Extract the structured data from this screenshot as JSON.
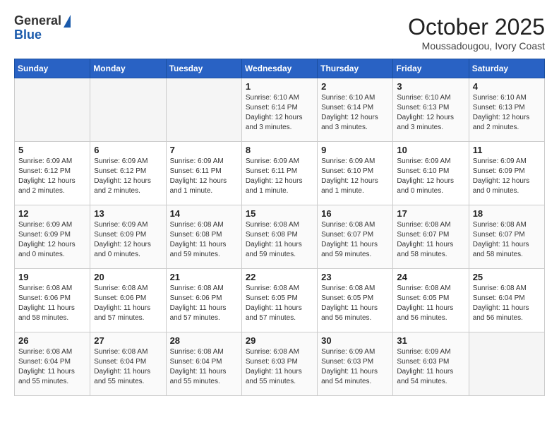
{
  "header": {
    "logo_general": "General",
    "logo_blue": "Blue",
    "title": "October 2025",
    "subtitle": "Moussadougou, Ivory Coast"
  },
  "weekdays": [
    "Sunday",
    "Monday",
    "Tuesday",
    "Wednesday",
    "Thursday",
    "Friday",
    "Saturday"
  ],
  "weeks": [
    [
      {
        "day": "",
        "info": ""
      },
      {
        "day": "",
        "info": ""
      },
      {
        "day": "",
        "info": ""
      },
      {
        "day": "1",
        "info": "Sunrise: 6:10 AM\nSunset: 6:14 PM\nDaylight: 12 hours\nand 3 minutes."
      },
      {
        "day": "2",
        "info": "Sunrise: 6:10 AM\nSunset: 6:14 PM\nDaylight: 12 hours\nand 3 minutes."
      },
      {
        "day": "3",
        "info": "Sunrise: 6:10 AM\nSunset: 6:13 PM\nDaylight: 12 hours\nand 3 minutes."
      },
      {
        "day": "4",
        "info": "Sunrise: 6:10 AM\nSunset: 6:13 PM\nDaylight: 12 hours\nand 2 minutes."
      }
    ],
    [
      {
        "day": "5",
        "info": "Sunrise: 6:09 AM\nSunset: 6:12 PM\nDaylight: 12 hours\nand 2 minutes."
      },
      {
        "day": "6",
        "info": "Sunrise: 6:09 AM\nSunset: 6:12 PM\nDaylight: 12 hours\nand 2 minutes."
      },
      {
        "day": "7",
        "info": "Sunrise: 6:09 AM\nSunset: 6:11 PM\nDaylight: 12 hours\nand 1 minute."
      },
      {
        "day": "8",
        "info": "Sunrise: 6:09 AM\nSunset: 6:11 PM\nDaylight: 12 hours\nand 1 minute."
      },
      {
        "day": "9",
        "info": "Sunrise: 6:09 AM\nSunset: 6:10 PM\nDaylight: 12 hours\nand 1 minute."
      },
      {
        "day": "10",
        "info": "Sunrise: 6:09 AM\nSunset: 6:10 PM\nDaylight: 12 hours\nand 0 minutes."
      },
      {
        "day": "11",
        "info": "Sunrise: 6:09 AM\nSunset: 6:09 PM\nDaylight: 12 hours\nand 0 minutes."
      }
    ],
    [
      {
        "day": "12",
        "info": "Sunrise: 6:09 AM\nSunset: 6:09 PM\nDaylight: 12 hours\nand 0 minutes."
      },
      {
        "day": "13",
        "info": "Sunrise: 6:09 AM\nSunset: 6:09 PM\nDaylight: 12 hours\nand 0 minutes."
      },
      {
        "day": "14",
        "info": "Sunrise: 6:08 AM\nSunset: 6:08 PM\nDaylight: 11 hours\nand 59 minutes."
      },
      {
        "day": "15",
        "info": "Sunrise: 6:08 AM\nSunset: 6:08 PM\nDaylight: 11 hours\nand 59 minutes."
      },
      {
        "day": "16",
        "info": "Sunrise: 6:08 AM\nSunset: 6:07 PM\nDaylight: 11 hours\nand 59 minutes."
      },
      {
        "day": "17",
        "info": "Sunrise: 6:08 AM\nSunset: 6:07 PM\nDaylight: 11 hours\nand 58 minutes."
      },
      {
        "day": "18",
        "info": "Sunrise: 6:08 AM\nSunset: 6:07 PM\nDaylight: 11 hours\nand 58 minutes."
      }
    ],
    [
      {
        "day": "19",
        "info": "Sunrise: 6:08 AM\nSunset: 6:06 PM\nDaylight: 11 hours\nand 58 minutes."
      },
      {
        "day": "20",
        "info": "Sunrise: 6:08 AM\nSunset: 6:06 PM\nDaylight: 11 hours\nand 57 minutes."
      },
      {
        "day": "21",
        "info": "Sunrise: 6:08 AM\nSunset: 6:06 PM\nDaylight: 11 hours\nand 57 minutes."
      },
      {
        "day": "22",
        "info": "Sunrise: 6:08 AM\nSunset: 6:05 PM\nDaylight: 11 hours\nand 57 minutes."
      },
      {
        "day": "23",
        "info": "Sunrise: 6:08 AM\nSunset: 6:05 PM\nDaylight: 11 hours\nand 56 minutes."
      },
      {
        "day": "24",
        "info": "Sunrise: 6:08 AM\nSunset: 6:05 PM\nDaylight: 11 hours\nand 56 minutes."
      },
      {
        "day": "25",
        "info": "Sunrise: 6:08 AM\nSunset: 6:04 PM\nDaylight: 11 hours\nand 56 minutes."
      }
    ],
    [
      {
        "day": "26",
        "info": "Sunrise: 6:08 AM\nSunset: 6:04 PM\nDaylight: 11 hours\nand 55 minutes."
      },
      {
        "day": "27",
        "info": "Sunrise: 6:08 AM\nSunset: 6:04 PM\nDaylight: 11 hours\nand 55 minutes."
      },
      {
        "day": "28",
        "info": "Sunrise: 6:08 AM\nSunset: 6:04 PM\nDaylight: 11 hours\nand 55 minutes."
      },
      {
        "day": "29",
        "info": "Sunrise: 6:08 AM\nSunset: 6:03 PM\nDaylight: 11 hours\nand 55 minutes."
      },
      {
        "day": "30",
        "info": "Sunrise: 6:09 AM\nSunset: 6:03 PM\nDaylight: 11 hours\nand 54 minutes."
      },
      {
        "day": "31",
        "info": "Sunrise: 6:09 AM\nSunset: 6:03 PM\nDaylight: 11 hours\nand 54 minutes."
      },
      {
        "day": "",
        "info": ""
      }
    ]
  ]
}
